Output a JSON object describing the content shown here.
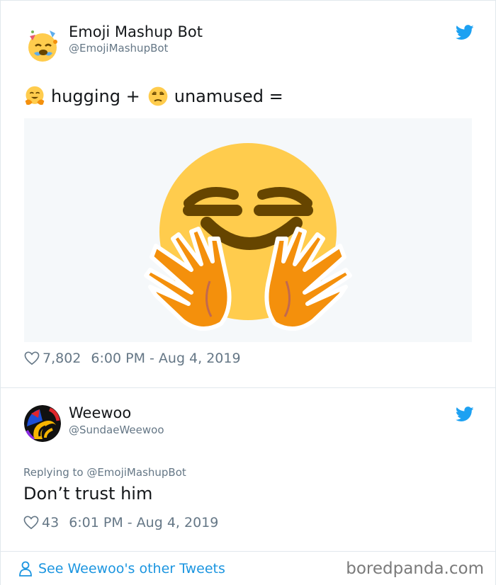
{
  "tweet1": {
    "name": "Emoji Mashup Bot",
    "handle": "@EmojiMashupBot",
    "text_part1": "hugging +",
    "text_part2": "unamused =",
    "likes": "7,802",
    "timestamp": "6:00 PM - Aug 4, 2019",
    "emoji_1": "hugging-face-icon",
    "emoji_2": "unamused-face-icon",
    "image": "hugging-unamused-mashup-emoji"
  },
  "tweet2": {
    "name": "Weewoo",
    "handle": "@SundaeWeewoo",
    "replying_to": "Replying to @EmojiMashupBot",
    "text": "Don’t trust him",
    "likes": "43",
    "timestamp": "6:01 PM - Aug 4, 2019"
  },
  "footer": {
    "see_more": "See Weewoo's other Tweets",
    "watermark": "boredpanda.com"
  },
  "colors": {
    "twitter_blue": "#1da1f2",
    "link_blue": "#1b95e0",
    "gray_text": "#657786",
    "emoji_yellow": "#ffcc4d",
    "hand_orange": "#f4900c",
    "feature_brown": "#664500"
  }
}
